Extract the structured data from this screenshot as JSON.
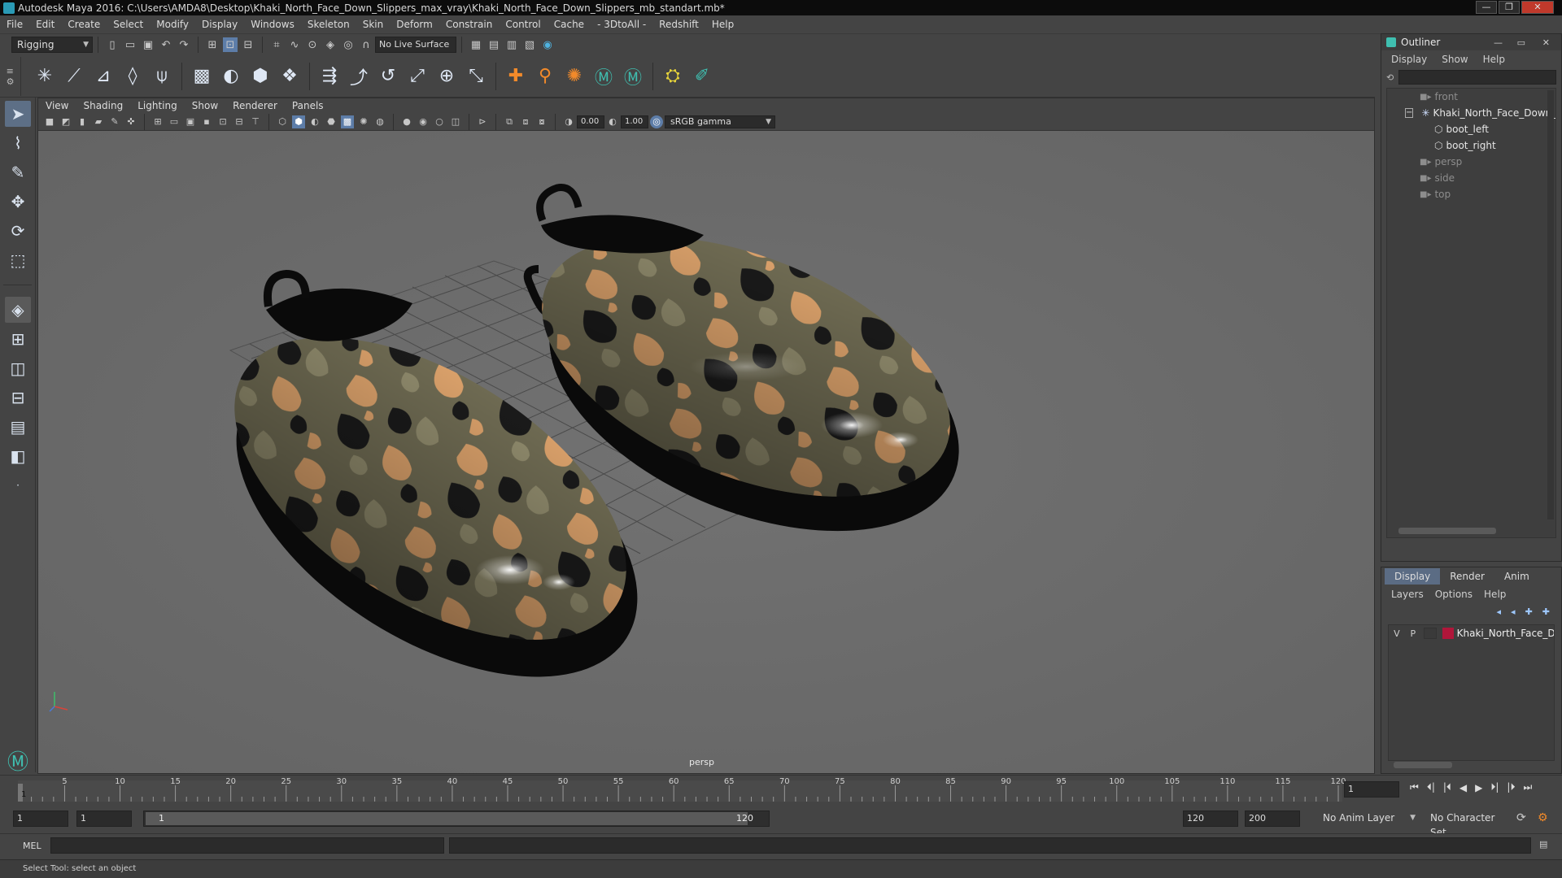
{
  "window": {
    "title": "Autodesk Maya 2016: C:\\Users\\AMDA8\\Desktop\\Khaki_North_Face_Down_Slippers_max_vray\\Khaki_North_Face_Down_Slippers_mb_standart.mb*",
    "minimize": "—",
    "maximize": "❐",
    "close": "✕"
  },
  "menubar": [
    "File",
    "Edit",
    "Create",
    "Select",
    "Modify",
    "Display",
    "Windows",
    "Skeleton",
    "Skin",
    "Deform",
    "Constrain",
    "Control",
    "Cache",
    "- 3DtoAll -",
    "Redshift",
    "Help"
  ],
  "statusline": {
    "menuset": "Rigging",
    "live_surface": "No Live Surface"
  },
  "viewport": {
    "menu": [
      "View",
      "Shading",
      "Lighting",
      "Show",
      "Renderer",
      "Panels"
    ],
    "exposure": "0.00",
    "gamma": "1.00",
    "color_space": "sRGB gamma",
    "camera_label": "persp"
  },
  "outliner": {
    "title": "Outliner",
    "menu": [
      "Display",
      "Show",
      "Help"
    ],
    "items": [
      {
        "label": "front",
        "indent": 2,
        "dim": true,
        "icon": "camera-icon"
      },
      {
        "label": "Khaki_North_Face_Down_",
        "indent": 2,
        "dim": false,
        "icon": "group-icon",
        "expander": "−"
      },
      {
        "label": "boot_left",
        "indent": 3,
        "dim": false,
        "icon": "mesh-icon"
      },
      {
        "label": "boot_right",
        "indent": 3,
        "dim": false,
        "icon": "mesh-icon"
      },
      {
        "label": "persp",
        "indent": 2,
        "dim": true,
        "icon": "camera-icon"
      },
      {
        "label": "side",
        "indent": 2,
        "dim": true,
        "icon": "camera-icon"
      },
      {
        "label": "top",
        "indent": 2,
        "dim": true,
        "icon": "camera-icon"
      }
    ]
  },
  "layers": {
    "tabs": [
      "Display",
      "Render",
      "Anim"
    ],
    "active_tab": "Display",
    "menu": [
      "Layers",
      "Options",
      "Help"
    ],
    "row": {
      "v": "V",
      "p": "P",
      "name": "Khaki_North_Face_Dov",
      "color": "#b0163a"
    }
  },
  "timeline": {
    "ticks": [
      5,
      10,
      15,
      20,
      25,
      30,
      35,
      40,
      45,
      50,
      55,
      60,
      65,
      70,
      75,
      80,
      85,
      90,
      95,
      100,
      105,
      110,
      115,
      120
    ],
    "current_frame_marker": "1",
    "current_frame": "1"
  },
  "range": {
    "start": "1",
    "playback_start": "1",
    "slider_start": "1",
    "slider_end": "120",
    "playback_end": "120",
    "end": "200",
    "anim_layer": "No Anim Layer",
    "character_set": "No Character Set"
  },
  "command": {
    "label": "MEL"
  },
  "help_line": "Select Tool: select an object",
  "colors": {
    "accent": "#5d7da8",
    "camo_tan": "#d9a06a",
    "camo_olive": "#6e6a52",
    "camo_black": "#1a1a1a",
    "manipulator_red": "#c0243a"
  }
}
